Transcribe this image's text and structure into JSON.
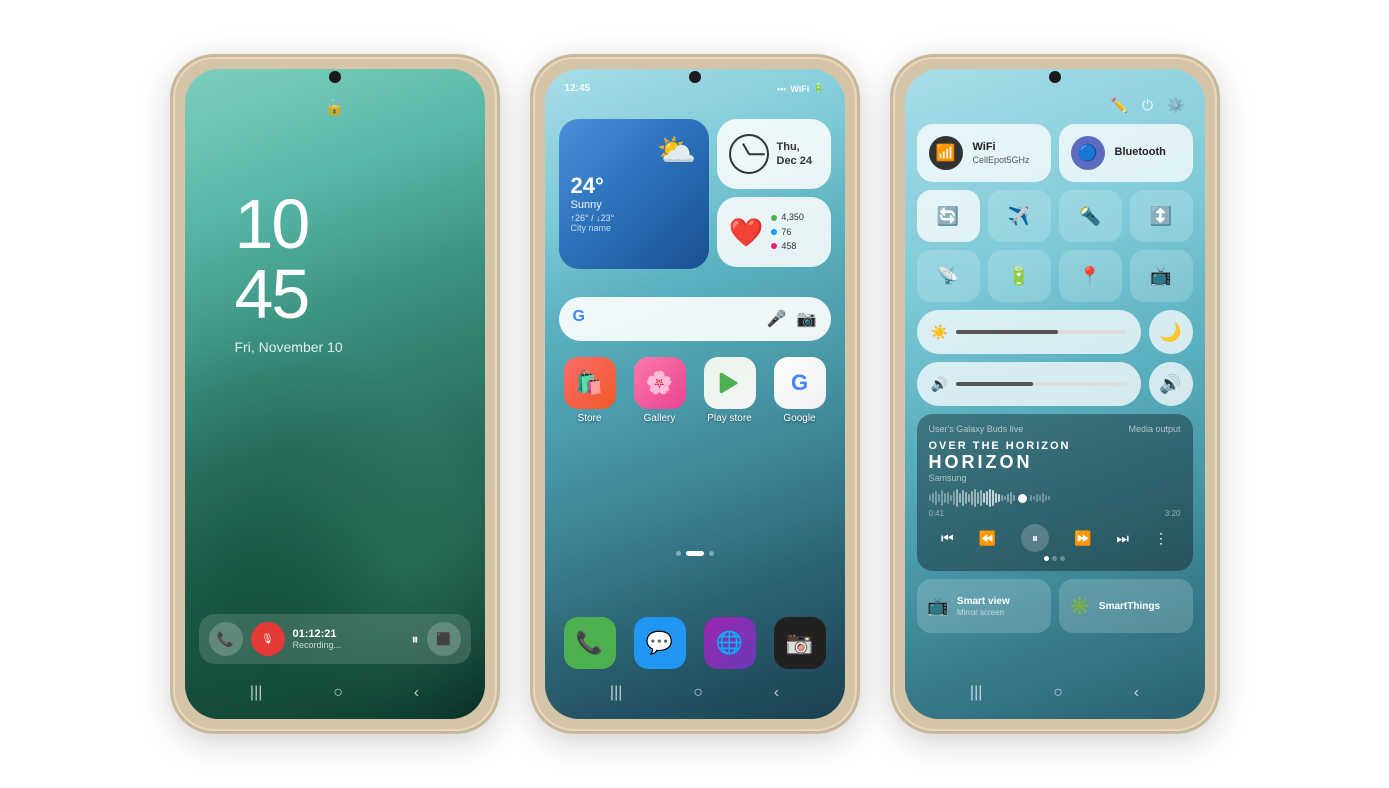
{
  "phone1": {
    "time": "10\n45",
    "time_hour": "10",
    "time_min": "45",
    "date": "Fri, November 10",
    "notification": {
      "time": "01:12:21",
      "subtitle": "Recording..."
    }
  },
  "phone2": {
    "status_time": "12:45",
    "weather": {
      "temp": "24°",
      "desc": "Sunny",
      "range": "↑26° / ↓23°",
      "city": "City name"
    },
    "clock_widget": {
      "day": "Thu,",
      "date": "Dec 24"
    },
    "health": {
      "steps": "4,350",
      "active": "76",
      "calories": "458"
    },
    "apps_row1": [
      {
        "label": "Store",
        "icon": "🛍️"
      },
      {
        "label": "Gallery",
        "icon": "🌸"
      },
      {
        "label": "Play store",
        "icon": "▶"
      },
      {
        "label": "Google",
        "icon": "G"
      }
    ],
    "apps_row2": [
      {
        "label": "Phone",
        "icon": "📞"
      },
      {
        "label": "Messages",
        "icon": "💬"
      },
      {
        "label": "Internet",
        "icon": "🌐"
      },
      {
        "label": "Camera",
        "icon": "📷"
      }
    ]
  },
  "phone3": {
    "wifi": {
      "label": "WiFi",
      "network": "CellEpot5GHz"
    },
    "bluetooth": {
      "label": "Bluetooth"
    },
    "media": {
      "device": "User's Galaxy Buds live",
      "output_label": "Media output",
      "title": "HORIZON",
      "song": "Over the Horizon",
      "artist": "Samsung",
      "time_current": "0:41",
      "time_total": "3:20"
    },
    "smart_view": {
      "label": "Smart view",
      "sub": "Mirror screen"
    },
    "smart_things": {
      "label": "SmartThings"
    }
  }
}
